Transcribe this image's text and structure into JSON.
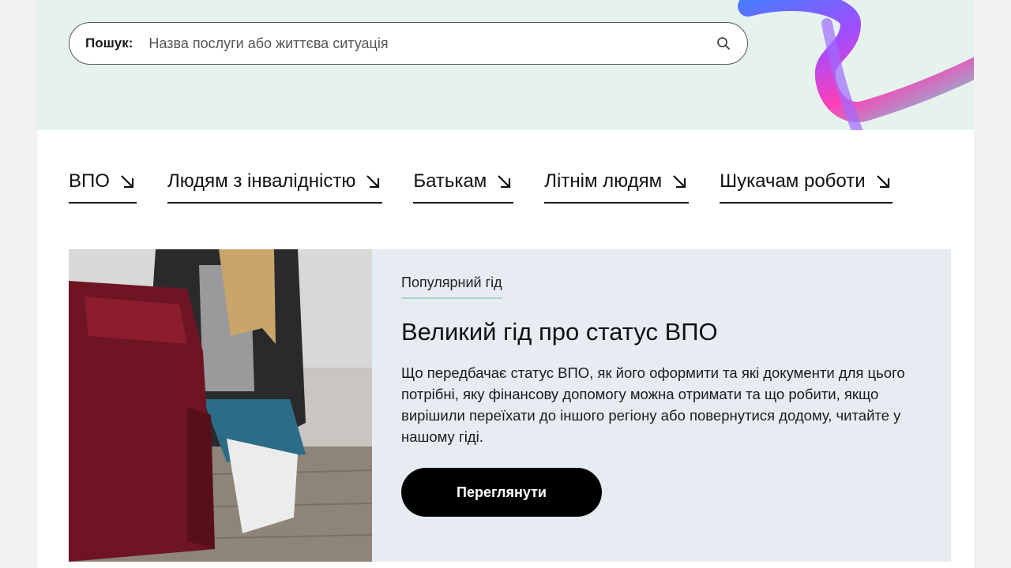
{
  "search": {
    "label": "Пошук:",
    "placeholder": "Назва послуги або життєва ситуація"
  },
  "categories": [
    {
      "label": "ВПО"
    },
    {
      "label": "Людям з інвалідністю"
    },
    {
      "label": "Батькам"
    },
    {
      "label": "Літнім людям"
    },
    {
      "label": "Шукачам роботи"
    }
  ],
  "featured": {
    "badge": "Популярний гід",
    "title": "Великий гід про статус ВПО",
    "description": "Що передбачає статус ВПО, як його оформити та які документи для цього потрібні, яку фінансову допомогу можна отримати та що робити, якщо вирішили переїхати до іншого регіону або повернутися додому, читайте у нашому гіді.",
    "button_label": "Переглянути"
  },
  "colors": {
    "hero_bg": "#e6f2ed",
    "card_bg": "#e6ecf2",
    "button_bg": "#000000",
    "badge_underline": "#a9d4c6"
  },
  "icons": {
    "search": "search-icon",
    "category_arrow": "arrow-down-right-icon"
  }
}
